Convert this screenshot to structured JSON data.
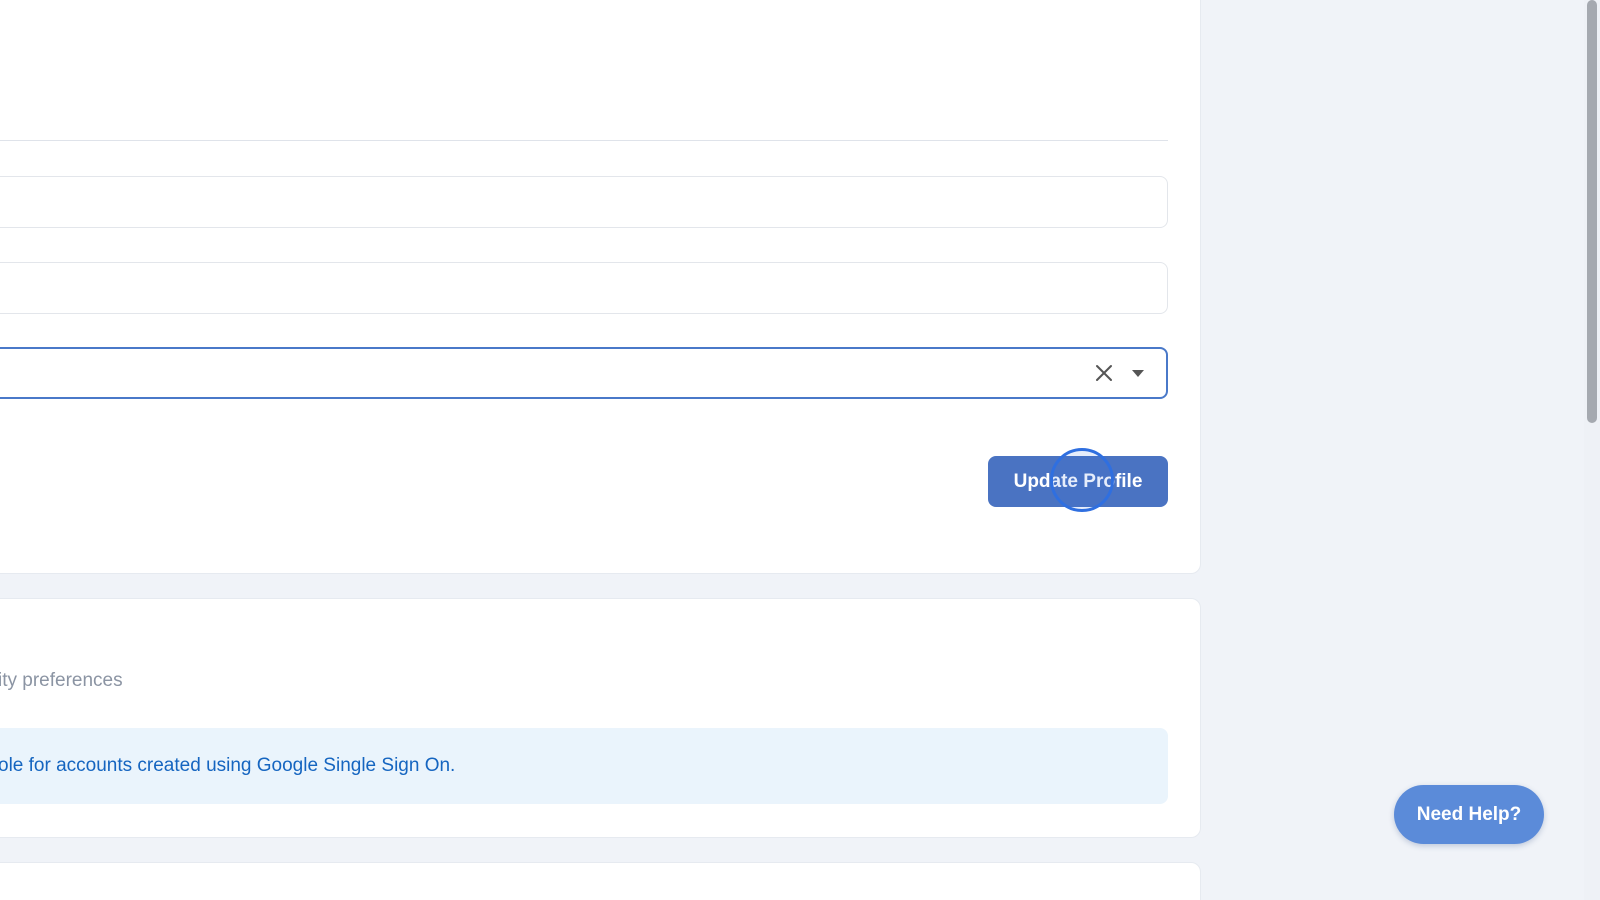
{
  "profile_form": {
    "field_1_value": "",
    "field_2_value": "",
    "select_value": "",
    "clear_icon": "close-x-icon",
    "dropdown_icon": "caret-down-icon",
    "update_label": "Update Profile"
  },
  "security": {
    "subtitle": "ity preferences",
    "info_text": "ole for accounts created using Google Single Sign On."
  },
  "help": {
    "label": "Need Help?"
  },
  "colors": {
    "primary_button": "#4a73c2",
    "focus_border": "#4a79c9",
    "help_button": "#5b8bd9",
    "info_background": "#eaf4fc",
    "info_text": "#1565c0",
    "page_background": "#f0f3f8"
  }
}
